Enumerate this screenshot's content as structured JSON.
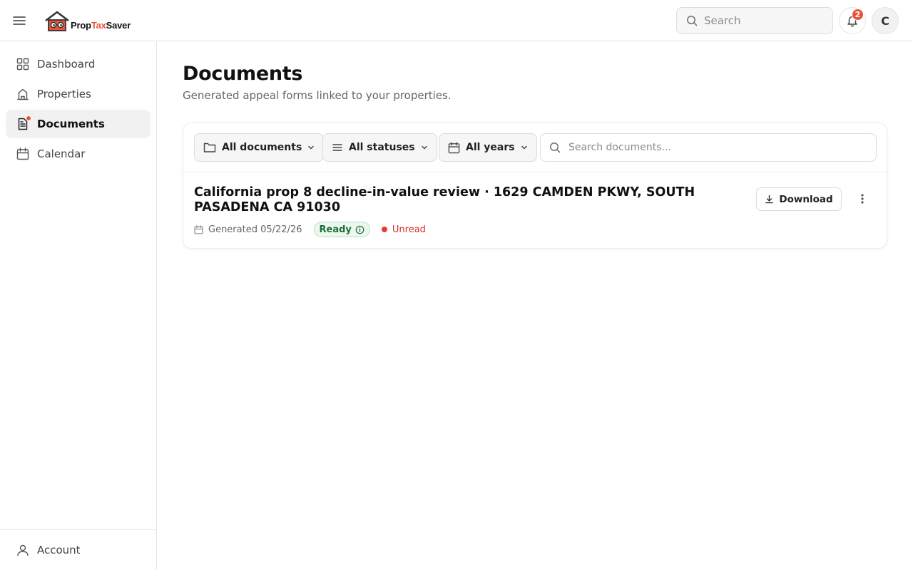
{
  "brand": {
    "name_part1": "Prop",
    "name_part2": "Tax",
    "name_part3": "Saver",
    "accent_color": "#e8543a"
  },
  "header": {
    "search_placeholder": "Search",
    "notification_count": "2",
    "avatar_initial": "C"
  },
  "sidebar": {
    "items": [
      {
        "label": "Dashboard",
        "icon": "grid-icon",
        "active": false
      },
      {
        "label": "Properties",
        "icon": "building-icon",
        "active": false
      },
      {
        "label": "Documents",
        "icon": "document-icon",
        "active": true,
        "has_dot": true
      },
      {
        "label": "Calendar",
        "icon": "calendar-icon",
        "active": false
      }
    ],
    "account_label": "Account"
  },
  "page": {
    "title": "Documents",
    "subtitle": "Generated appeal forms linked to your properties."
  },
  "filters": {
    "type": "All documents",
    "status": "All statuses",
    "year": "All years",
    "search_placeholder": "Search documents..."
  },
  "documents": [
    {
      "title": "California prop 8 decline-in-value review · 1629 CAMDEN PKWY, SOUTH PASADENA CA 91030",
      "generated": "Generated 05/22/26",
      "status": "Ready",
      "read_state": "Unread",
      "download_label": "Download"
    }
  ]
}
